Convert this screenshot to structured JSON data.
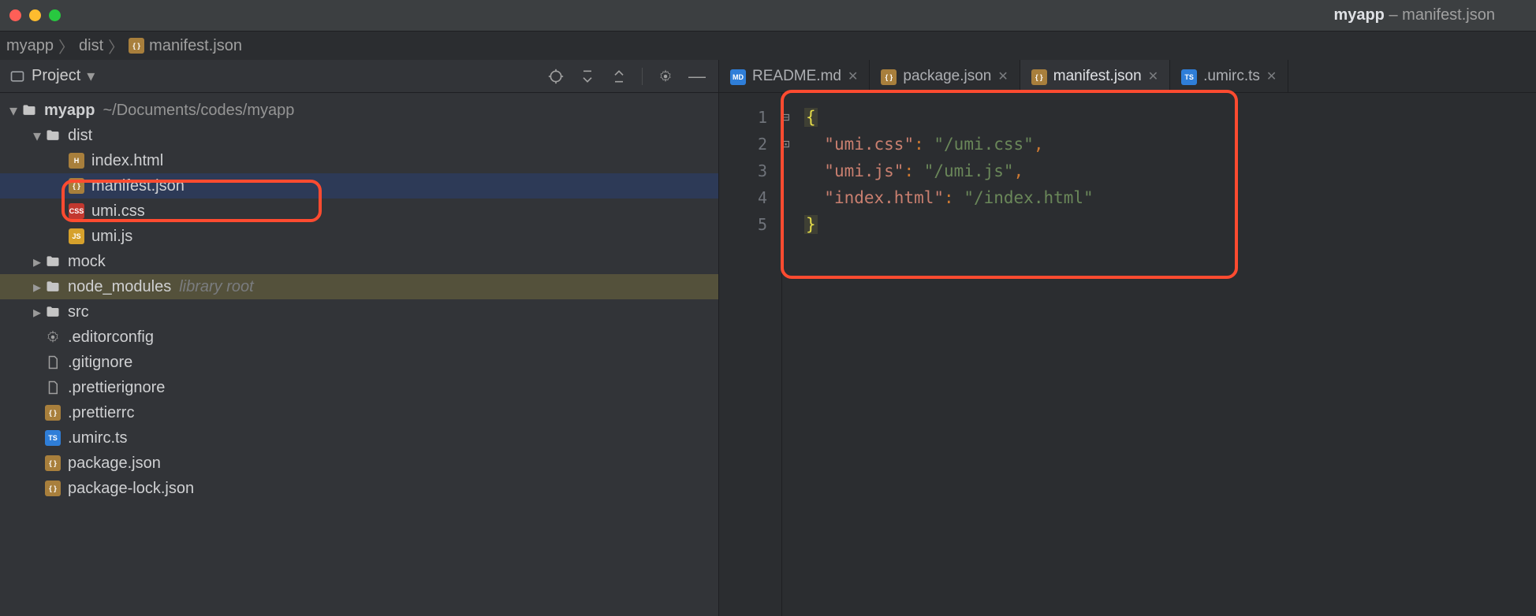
{
  "window": {
    "project_name": "myapp",
    "title_file": "manifest.json"
  },
  "breadcrumb": {
    "items": [
      "myapp",
      "dist",
      "manifest.json"
    ]
  },
  "project_panel": {
    "title": "Project"
  },
  "tree": {
    "root_name": "myapp",
    "root_path": "~/Documents/codes/myapp",
    "items": [
      {
        "name": "dist",
        "type": "dir",
        "depth": 1,
        "expanded": true
      },
      {
        "name": "index.html",
        "type": "html",
        "depth": 2
      },
      {
        "name": "manifest.json",
        "type": "json",
        "depth": 2,
        "selected": true
      },
      {
        "name": "umi.css",
        "type": "css",
        "depth": 2
      },
      {
        "name": "umi.js",
        "type": "js",
        "depth": 2
      },
      {
        "name": "mock",
        "type": "dir",
        "depth": 1,
        "expanded": false
      },
      {
        "name": "node_modules",
        "type": "dir",
        "depth": 1,
        "expanded": false,
        "lib": true,
        "hint": "library root"
      },
      {
        "name": "src",
        "type": "dir",
        "depth": 1,
        "expanded": false
      },
      {
        "name": ".editorconfig",
        "type": "gear",
        "depth": 1
      },
      {
        "name": ".gitignore",
        "type": "txt",
        "depth": 1
      },
      {
        "name": ".prettierignore",
        "type": "txt",
        "depth": 1
      },
      {
        "name": ".prettierrc",
        "type": "json",
        "depth": 1
      },
      {
        "name": ".umirc.ts",
        "type": "ts",
        "depth": 1
      },
      {
        "name": "package.json",
        "type": "json",
        "depth": 1
      },
      {
        "name": "package-lock.json",
        "type": "json",
        "depth": 1
      }
    ]
  },
  "tabs": [
    {
      "label": "README.md",
      "type": "md"
    },
    {
      "label": "package.json",
      "type": "json"
    },
    {
      "label": "manifest.json",
      "type": "json",
      "active": true
    },
    {
      "label": ".umirc.ts",
      "type": "ts"
    }
  ],
  "editor": {
    "line_numbers": [
      "1",
      "2",
      "3",
      "4",
      "5"
    ],
    "lines": [
      [
        {
          "t": "brace",
          "v": "{"
        }
      ],
      [
        {
          "t": "pad",
          "v": "  "
        },
        {
          "t": "key",
          "v": "\"umi.css\""
        },
        {
          "t": "colon",
          "v": ": "
        },
        {
          "t": "str",
          "v": "\"/umi.css\""
        },
        {
          "t": "punc",
          "v": ","
        }
      ],
      [
        {
          "t": "pad",
          "v": "  "
        },
        {
          "t": "key",
          "v": "\"umi.js\""
        },
        {
          "t": "colon",
          "v": ": "
        },
        {
          "t": "str",
          "v": "\"/umi.js\""
        },
        {
          "t": "punc",
          "v": ","
        }
      ],
      [
        {
          "t": "pad",
          "v": "  "
        },
        {
          "t": "key",
          "v": "\"index.html\""
        },
        {
          "t": "colon",
          "v": ": "
        },
        {
          "t": "str",
          "v": "\"/index.html\""
        }
      ],
      [
        {
          "t": "brace",
          "v": "}"
        }
      ]
    ]
  }
}
